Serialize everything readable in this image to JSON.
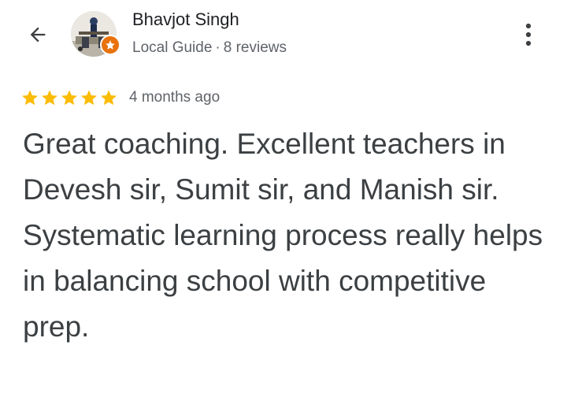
{
  "header": {
    "back_icon": "arrow-left-icon",
    "more_icon": "vertical-dots-icon"
  },
  "reviewer": {
    "name": "Bhavjot Singh",
    "badge_icon": "local-guide-star-icon",
    "badge_color": "#e8710a",
    "level": "Local Guide",
    "separator": "·",
    "review_count": "8 reviews"
  },
  "review": {
    "rating": 5,
    "rating_max": 5,
    "star_color": "#fbbc04",
    "date": "4 months ago",
    "text": "Great coaching. Excellent teachers in Devesh sir, Sumit sir, and Manish sir. Systematic learning process really helps in balancing school with competitive prep."
  }
}
